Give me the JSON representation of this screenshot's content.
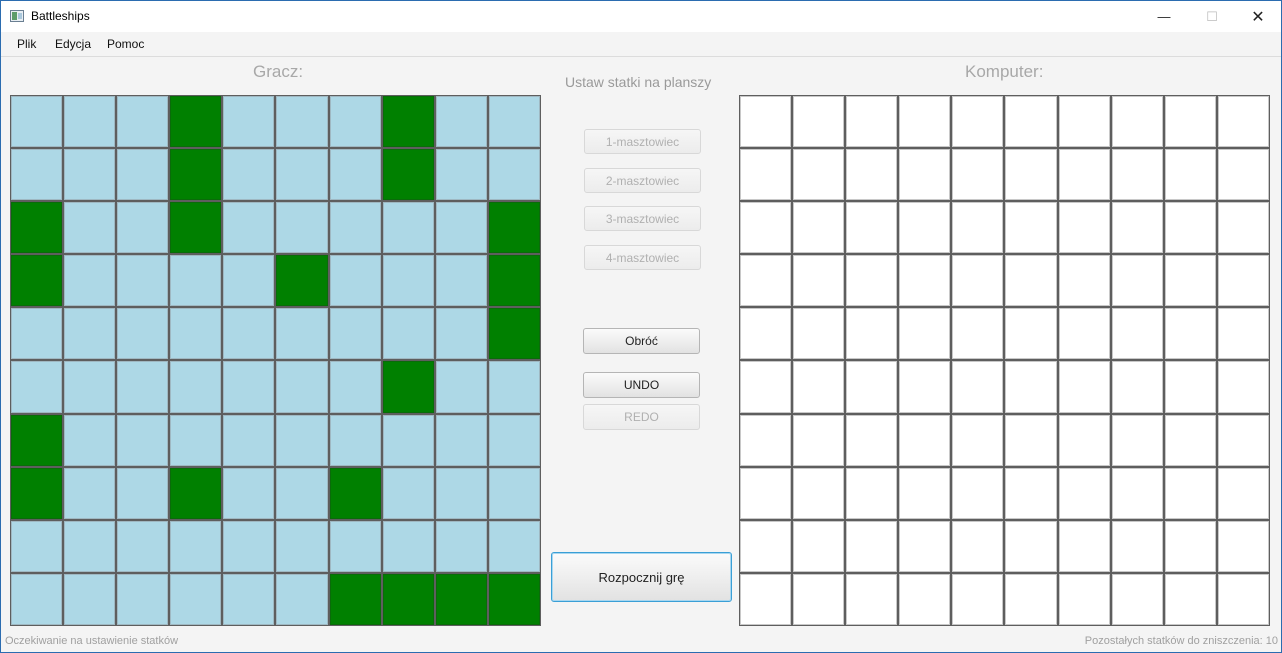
{
  "window": {
    "title": "Battleships",
    "min_icon": "minimize-icon",
    "max_icon": "maximize-icon",
    "close_icon": "close-icon"
  },
  "menu": {
    "items": [
      "Plik",
      "Edycja",
      "Pomoc"
    ]
  },
  "player": {
    "title": "Gracz:",
    "board": [
      [
        0,
        0,
        0,
        1,
        0,
        0,
        0,
        1,
        0,
        0
      ],
      [
        0,
        0,
        0,
        1,
        0,
        0,
        0,
        1,
        0,
        0
      ],
      [
        1,
        0,
        0,
        1,
        0,
        0,
        0,
        0,
        0,
        1
      ],
      [
        1,
        0,
        0,
        0,
        0,
        1,
        0,
        0,
        0,
        1
      ],
      [
        0,
        0,
        0,
        0,
        0,
        0,
        0,
        0,
        0,
        1
      ],
      [
        0,
        0,
        0,
        0,
        0,
        0,
        0,
        1,
        0,
        0
      ],
      [
        1,
        0,
        0,
        0,
        0,
        0,
        0,
        0,
        0,
        0
      ],
      [
        1,
        0,
        0,
        1,
        0,
        0,
        1,
        0,
        0,
        0
      ],
      [
        0,
        0,
        0,
        0,
        0,
        0,
        0,
        0,
        0,
        0
      ],
      [
        0,
        0,
        0,
        0,
        0,
        0,
        1,
        1,
        1,
        1
      ]
    ]
  },
  "computer": {
    "title": "Komputer:"
  },
  "controls": {
    "heading": "Ustaw statki na planszy",
    "ship_buttons": [
      "1-masztowiec",
      "2-masztowiec",
      "3-masztowiec",
      "4-masztowiec"
    ],
    "rotate": "Obróć",
    "undo": "UNDO",
    "redo": "REDO",
    "start": "Rozpocznij grę"
  },
  "status": {
    "left": "Oczekiwanie na ustawienie statków",
    "right": "Pozostałych statków do zniszczenia: 10"
  },
  "colors": {
    "ship": "#008000",
    "water": "#add8e6",
    "empty": "#ffffff"
  }
}
